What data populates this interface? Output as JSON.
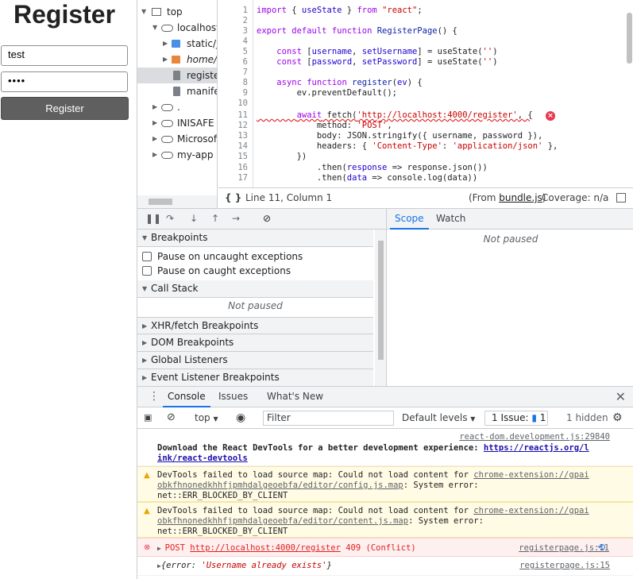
{
  "app": {
    "heading": "Register",
    "username_value": "test",
    "password_value": "••••",
    "submit_label": "Register"
  },
  "tree": {
    "items": [
      {
        "label": "top",
        "icon": "frame-icon"
      },
      {
        "label": "localhost:",
        "icon": "cloud-icon"
      },
      {
        "label": "static/js",
        "icon": "folder-icon"
      },
      {
        "label": "home/c",
        "icon": "folder-icon"
      },
      {
        "label": "registe",
        "icon": "file-icon"
      },
      {
        "label": "manife",
        "icon": "file-icon"
      },
      {
        "label": ".",
        "icon": "cloud-icon"
      },
      {
        "label": "INISAFE C",
        "icon": "cloud-icon"
      },
      {
        "label": "Microsoft",
        "icon": "cloud-icon"
      },
      {
        "label": "my-app",
        "icon": "cloud-icon"
      }
    ]
  },
  "editor": {
    "line_numbers": [
      "1",
      "2",
      "3",
      "4",
      "5",
      "6",
      "7",
      "8",
      "9",
      "10",
      "11",
      "12",
      "13",
      "14",
      "15",
      "16",
      "17"
    ],
    "error_badge": "×"
  },
  "status": {
    "braces": "{ }",
    "position": "Line 11, Column 1",
    "from_prefix": "(From ",
    "from_file": "bundle.js",
    "from_suffix": ")",
    "coverage": "Coverage: n/a"
  },
  "debugger": {
    "sections": {
      "breakpoints": "Breakpoints",
      "call_stack": "Call Stack",
      "xhr": "XHR/fetch Breakpoints",
      "dom": "DOM Breakpoints",
      "global": "Global Listeners",
      "event": "Event Listener Breakpoints"
    },
    "pause_uncaught": "Pause on uncaught exceptions",
    "pause_caught": "Pause on caught exceptions",
    "call_stack_status": "Not paused"
  },
  "scope": {
    "tab_scope": "Scope",
    "tab_watch": "Watch",
    "status": "Not paused"
  },
  "drawer": {
    "tab_console": "Console",
    "tab_issues": "Issues",
    "tab_whats_new": "What's New",
    "close": "✕"
  },
  "console_toolbar": {
    "context": "top",
    "filter_placeholder": "Filter",
    "levels": "Default levels",
    "issues_label": "1 Issue:",
    "issues_count": "1",
    "hidden": "1 hidden"
  },
  "console": {
    "msg1": {
      "source": "react-dom.development.js:29840",
      "text": "Download the React DevTools for a better development experience: ",
      "link1": "https://reactjs.org/l",
      "link2": "ink/react-devtools"
    },
    "msg2": {
      "line1": "DevTools failed to load source map: Could not load content for ",
      "link1": "chrome-extension://gpai",
      "link2": "obkfhnonedkhhfjpmhdalgeoebfa/editor/config.js.map",
      "line2_suffix": ": System error:",
      "line3": "net::ERR_BLOCKED_BY_CLIENT"
    },
    "msg3": {
      "line1": "DevTools failed to load source map: Could not load content for ",
      "link1": "chrome-extension://gpai",
      "link2": "obkfhnonedkhhfjpmhdalgeoebfa/editor/content.js.map",
      "line2_suffix": ": System error:",
      "line3": "net::ERR_BLOCKED_BY_CLIENT"
    },
    "msg4": {
      "method": "POST ",
      "url": "http://localhost:4000/register",
      "status": " 409 (Conflict)",
      "source": "registerpage.js:11"
    },
    "msg5": {
      "prefix": "{error: ",
      "value": "'Username already exists'",
      "suffix": "}",
      "source": "registerpage.js:15"
    }
  }
}
